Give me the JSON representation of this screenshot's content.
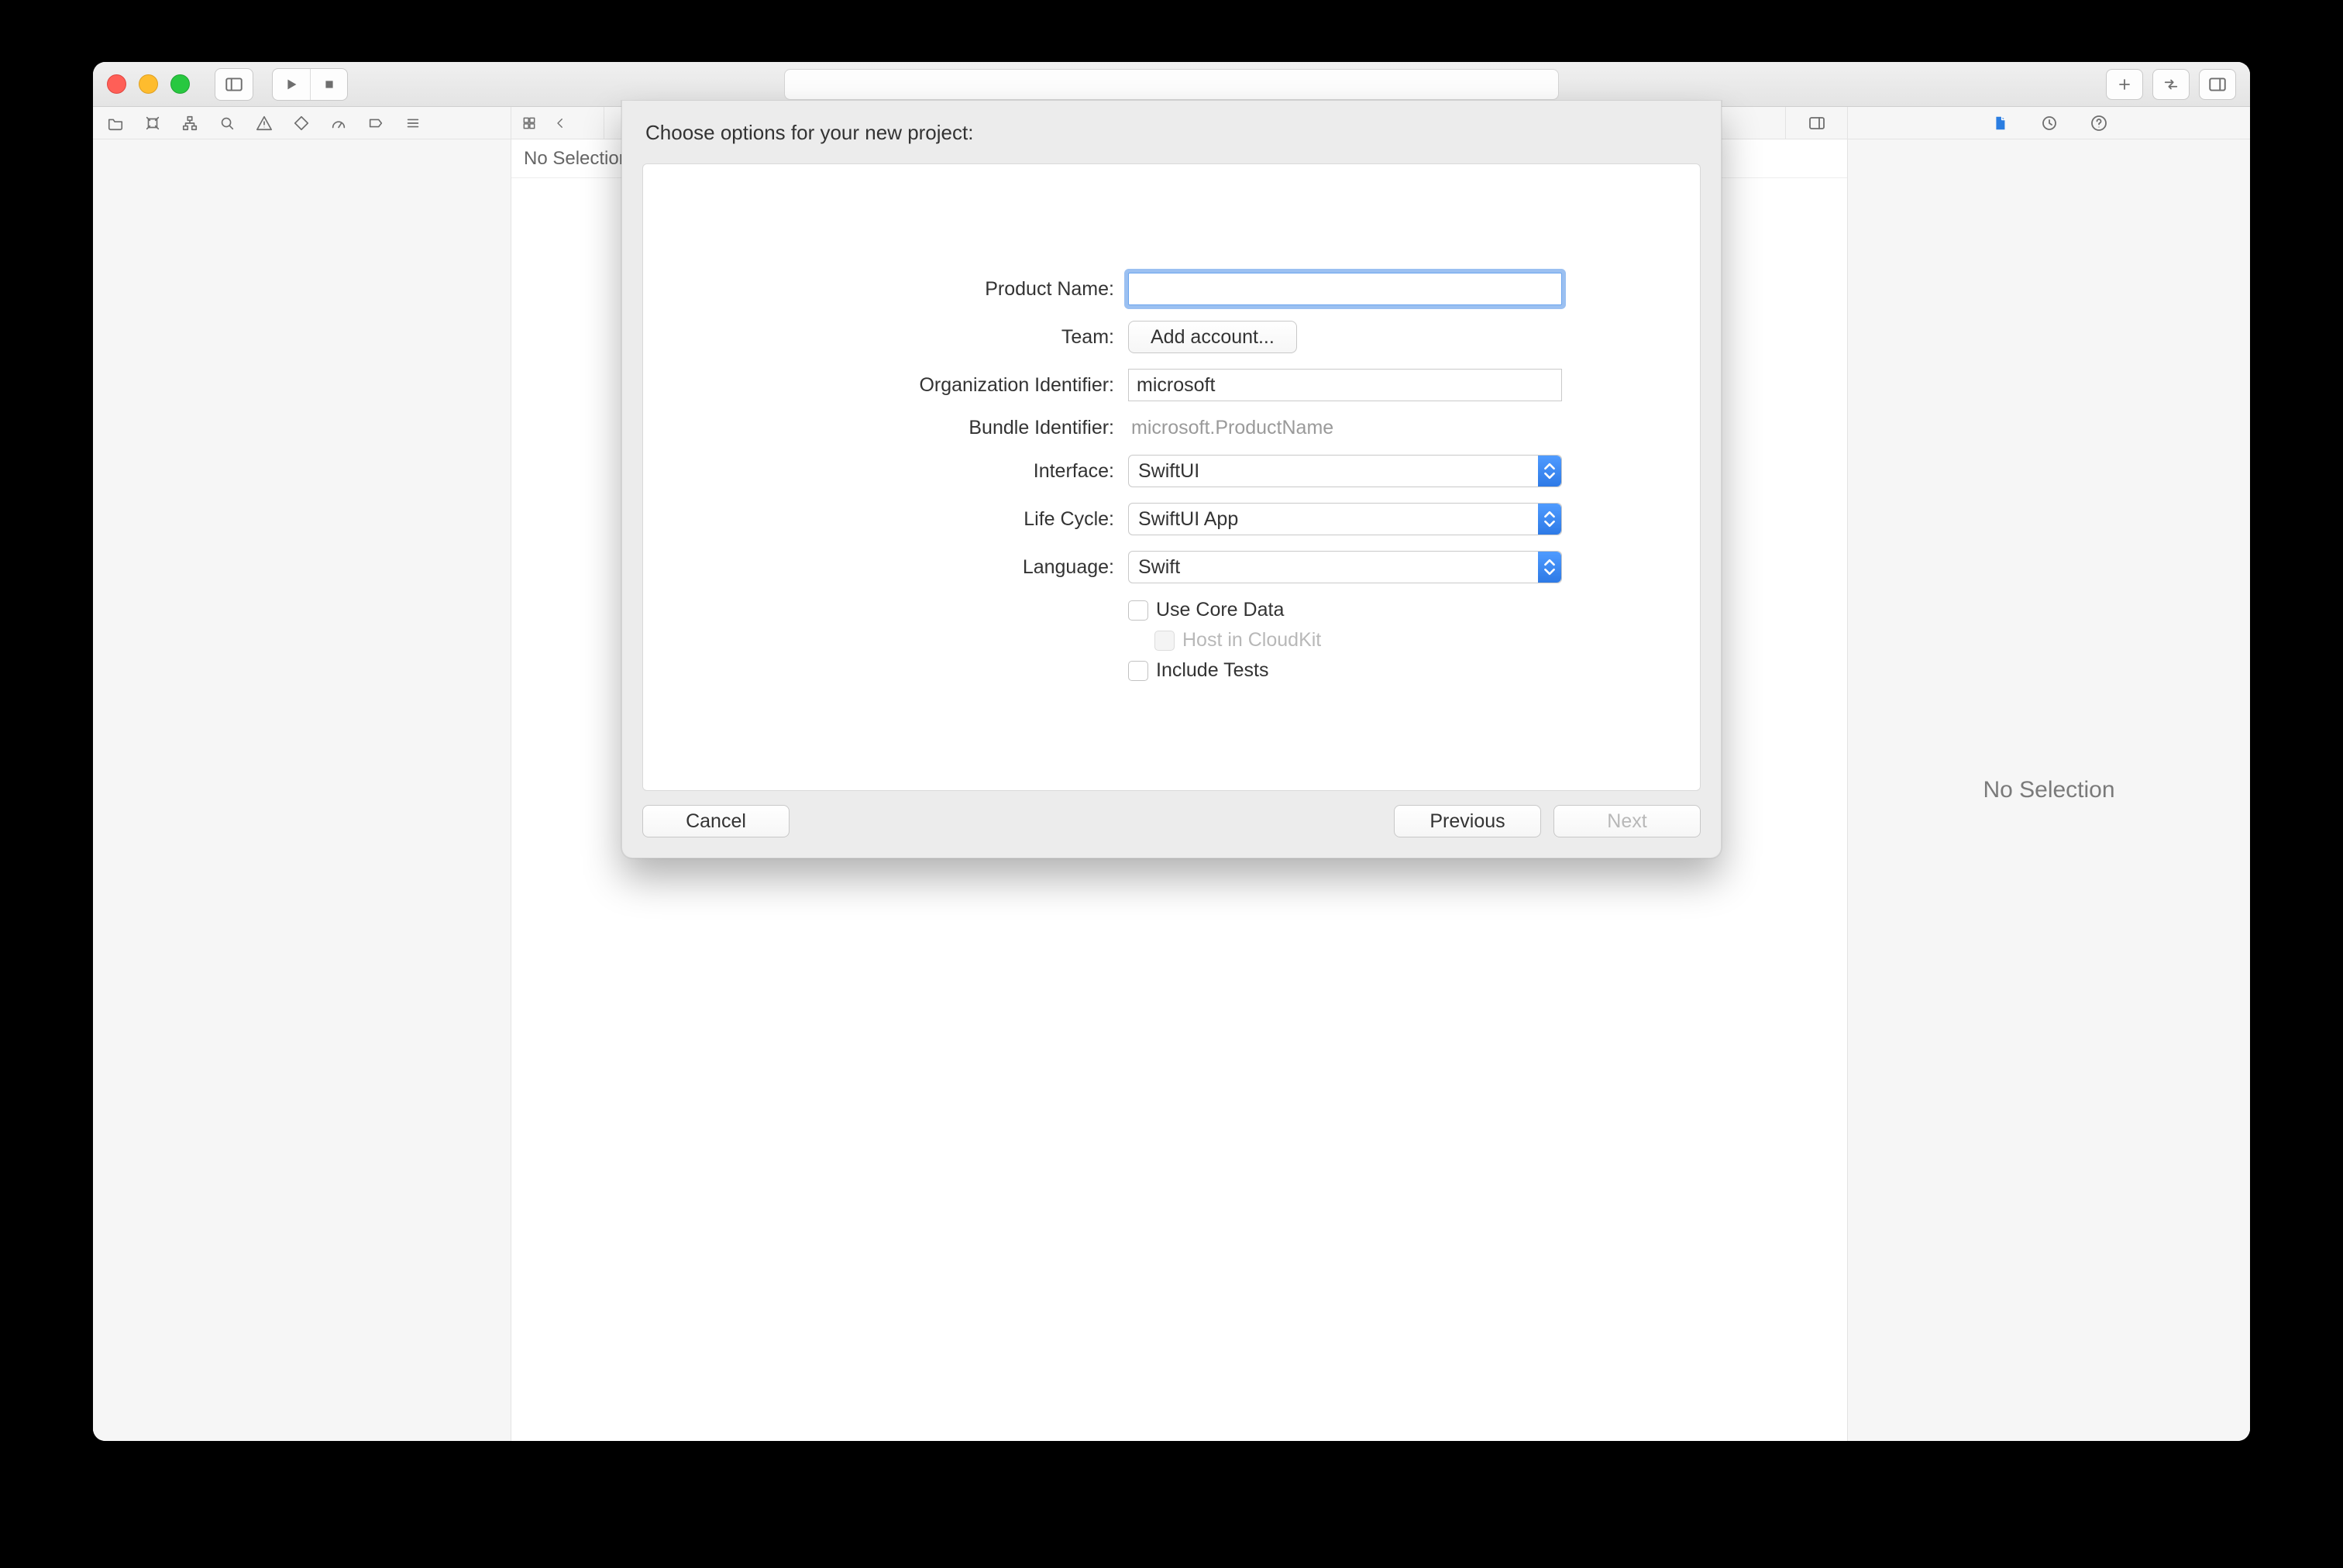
{
  "window": {},
  "editor": {
    "no_selection_label": "No Selection"
  },
  "inspector": {
    "no_selection_label": "No Selection"
  },
  "sheet": {
    "title": "Choose options for your new project:",
    "labels": {
      "product_name": "Product Name:",
      "team": "Team:",
      "org_identifier": "Organization Identifier:",
      "bundle_identifier": "Bundle Identifier:",
      "interface": "Interface:",
      "life_cycle": "Life Cycle:",
      "language": "Language:"
    },
    "values": {
      "product_name": "",
      "team_button": "Add account...",
      "org_identifier": "microsoft",
      "bundle_identifier": "microsoft.ProductName",
      "interface": "SwiftUI",
      "life_cycle": "SwiftUI App",
      "language": "Swift"
    },
    "checks": {
      "use_core_data": "Use Core Data",
      "host_cloudkit": "Host in CloudKit",
      "include_tests": "Include Tests"
    },
    "footer": {
      "cancel": "Cancel",
      "previous": "Previous",
      "next": "Next"
    }
  }
}
